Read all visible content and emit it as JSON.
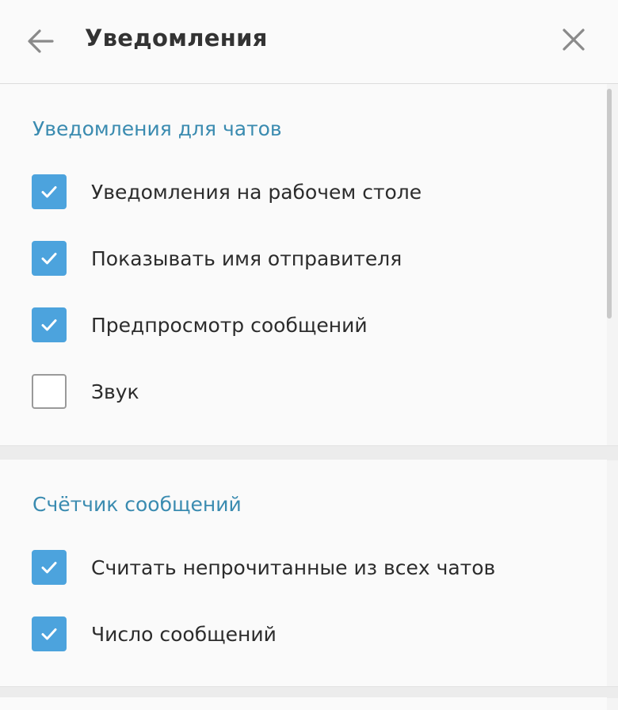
{
  "header": {
    "title": "Уведомления",
    "back_icon": "arrow-left-icon",
    "close_icon": "close-icon"
  },
  "sections": [
    {
      "title": "Уведомления для чатов",
      "items": [
        {
          "label": "Уведомления на рабочем столе",
          "checked": true
        },
        {
          "label": "Показывать имя отправителя",
          "checked": true
        },
        {
          "label": "Предпросмотр сообщений",
          "checked": true
        },
        {
          "label": "Звук",
          "checked": false
        }
      ]
    },
    {
      "title": "Счётчик сообщений",
      "items": [
        {
          "label": "Считать непрочитанные из всех чатов",
          "checked": true
        },
        {
          "label": "Число сообщений",
          "checked": true
        }
      ]
    }
  ],
  "colors": {
    "accent": "#4ca3dd",
    "section_title": "#3a8bb0"
  }
}
